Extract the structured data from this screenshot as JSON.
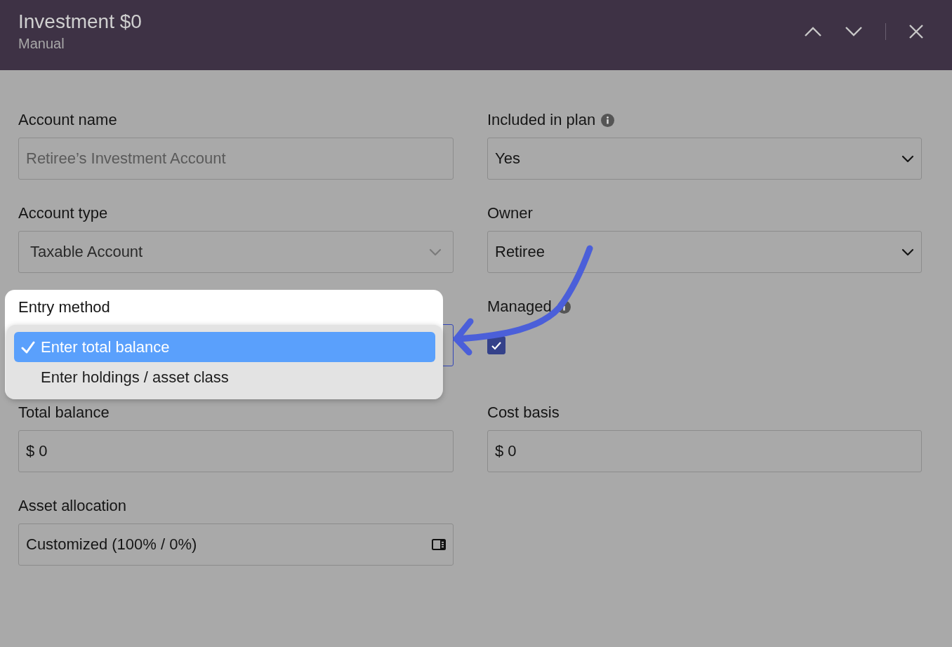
{
  "header": {
    "title": "Investment $0",
    "subtitle": "Manual"
  },
  "fields": [
    {
      "kind": "text",
      "label": "Account name",
      "value": "Retiree’s Investment Account",
      "disabled": true
    },
    {
      "kind": "select",
      "label": "Included in plan",
      "info": true,
      "value": "Yes",
      "disabled": false
    },
    {
      "kind": "select",
      "label": "Account type",
      "value": "Taxable Account",
      "disabled": true
    },
    {
      "kind": "select",
      "label": "Owner",
      "value": "Retiree",
      "disabled": false
    },
    {
      "kind": "menu",
      "label": "Entry method",
      "focused": true,
      "options": [
        {
          "label": "Enter total balance",
          "selected": true
        },
        {
          "label": "Enter holdings / asset class",
          "selected": false
        }
      ]
    },
    {
      "kind": "checkbox",
      "label": "Managed",
      "info": true,
      "checked": true
    },
    {
      "kind": "text",
      "label": "Total balance",
      "value": "$ 0",
      "disabled": false
    },
    {
      "kind": "text",
      "label": "Cost basis",
      "value": "$ 0",
      "disabled": false
    },
    {
      "kind": "allocation",
      "label": "Asset allocation",
      "value": "Customized (100% / 0%)"
    }
  ]
}
